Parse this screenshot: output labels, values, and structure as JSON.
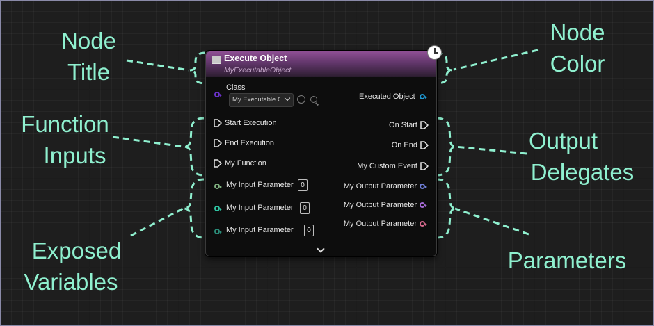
{
  "callouts": {
    "node_title": [
      "Node",
      "Title"
    ],
    "node_color": [
      "Node",
      "Color"
    ],
    "function_inputs": [
      "Function",
      "Inputs"
    ],
    "output_delegates": [
      "Output",
      "Delegates"
    ],
    "exposed_variables": [
      "Exposed",
      "Variables"
    ],
    "parameters": "Parameters"
  },
  "node": {
    "title": "Execute Object",
    "subtitle": "MyExecutableObject",
    "header_color": "#8e4f94",
    "class_label": "Class",
    "class_value": "My Executable O",
    "executed_object_label": "Executed Object",
    "function_inputs": [
      "Start Execution",
      "End Execution",
      "My Function"
    ],
    "output_delegates": [
      "On Start",
      "On End",
      "My Custom Event"
    ],
    "input_parameters": [
      {
        "label": "My Input Parameter",
        "value": "0",
        "color": "#7fb07f"
      },
      {
        "label": "My Input Parameter",
        "value": "0",
        "color": "#2fc4a2"
      },
      {
        "label": "My Input Parameter",
        "value": "0",
        "color": "#2a8b78"
      }
    ],
    "output_parameters": [
      {
        "label": "My Output Parameter",
        "color": "#6f7fd8"
      },
      {
        "label": "My Output Parameter",
        "color": "#a56ad6"
      },
      {
        "label": "My Output Parameter",
        "color": "#d86a8e"
      }
    ]
  },
  "colors": {
    "callout_text": "#8ff0cf",
    "class_pin": "#6a32c9",
    "object_pin": "#1e9ad6"
  }
}
